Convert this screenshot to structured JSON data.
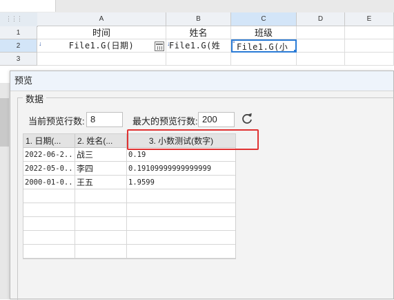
{
  "spreadsheet": {
    "columns": [
      "A",
      "B",
      "C",
      "D",
      "E"
    ],
    "rows": [
      "1",
      "2",
      "3"
    ],
    "row1": [
      "时间",
      "姓名",
      "班级"
    ],
    "row2": [
      "File1.G(日期)",
      "File1.G(姓",
      "File1.G(小"
    ]
  },
  "dialog": {
    "title": "预览",
    "group_title": "数据",
    "current_rows_label": "当前预览行数:",
    "current_rows_value": "8",
    "max_rows_label": "最大的预览行数:",
    "max_rows_value": "200",
    "refresh_icon": "refresh-icon",
    "table": {
      "headers": [
        "1. 日期(...",
        "2. 姓名(...",
        "3. 小数测试(数字)"
      ],
      "rows": [
        [
          "2022-06-2...",
          "战三",
          "0.19"
        ],
        [
          "2022-05-0...",
          "李四",
          "0.19109999999999999"
        ],
        [
          "2000-01-0...",
          "王五",
          "1.9599"
        ]
      ]
    }
  },
  "colors": {
    "highlight": "#e03232",
    "selection": "#2a7bd6"
  }
}
